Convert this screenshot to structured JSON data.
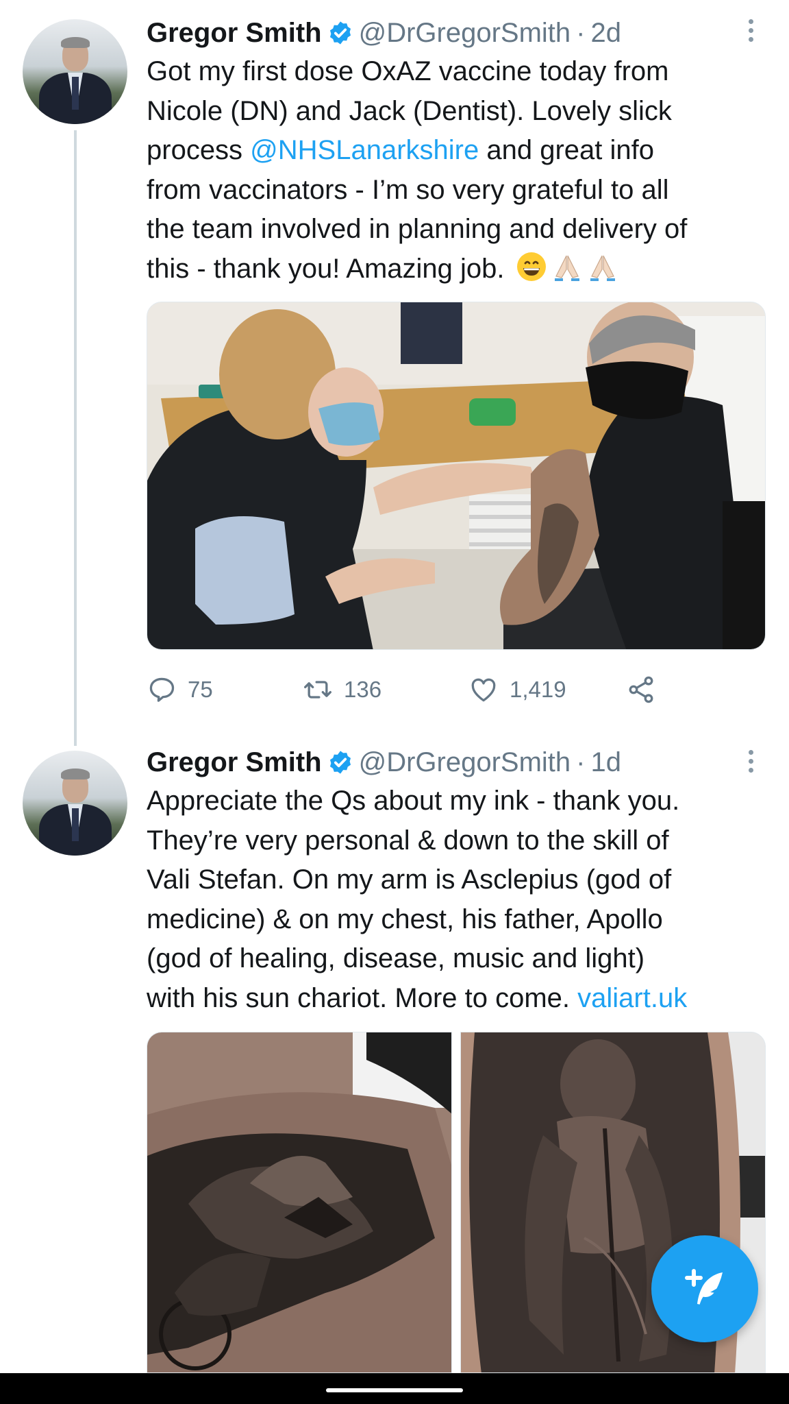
{
  "tweets": [
    {
      "name": "Gregor Smith",
      "handle": "@DrGregorSmith",
      "separator": "·",
      "time": "2d",
      "text_lines": [
        [
          {
            "t": "Got my first dose OxAZ vaccine today from"
          }
        ],
        [
          {
            "t": "Nicole (DN) and Jack (Dentist). Lovely slick"
          }
        ],
        [
          {
            "t": "process "
          },
          {
            "t": "@NHSLanarkshire",
            "link": true
          },
          {
            "t": " and great info"
          }
        ],
        [
          {
            "t": "from vaccinators - I’m so very grateful to all"
          }
        ],
        [
          {
            "t": "the team involved in planning and delivery of"
          }
        ],
        [
          {
            "t": "this - thank you! Amazing job. "
          },
          {
            "emoji": [
              "grinning-face",
              "folded-hands",
              "folded-hands"
            ]
          }
        ]
      ],
      "stats": {
        "replies": "75",
        "retweets": "136",
        "likes": "1,419"
      }
    },
    {
      "name": "Gregor Smith",
      "handle": "@DrGregorSmith",
      "separator": "·",
      "time": "1d",
      "text_lines": [
        [
          {
            "t": "Appreciate the Qs about my ink - thank you."
          }
        ],
        [
          {
            "t": "They’re very personal & down to the skill of"
          }
        ],
        [
          {
            "t": "Vali Stefan. On my arm is Asclepius (god of"
          }
        ],
        [
          {
            "t": "medicine) & on my chest, his father, Apollo"
          }
        ],
        [
          {
            "t": "(god of healing, disease, music and light)"
          }
        ],
        [
          {
            "t": "with his sun chariot. More to come. "
          },
          {
            "t": "valiart.uk",
            "link": true
          }
        ]
      ]
    }
  ],
  "icons": {
    "verified": "verified-badge-icon",
    "reply": "reply-icon",
    "retweet": "retweet-icon",
    "like": "heart-icon",
    "share": "share-icon",
    "compose": "compose-tweet-icon",
    "more": "more-vertical-icon"
  },
  "colors": {
    "accent": "#1da1f2",
    "secondary_text": "#657786",
    "thread_line": "#cfd9de"
  }
}
